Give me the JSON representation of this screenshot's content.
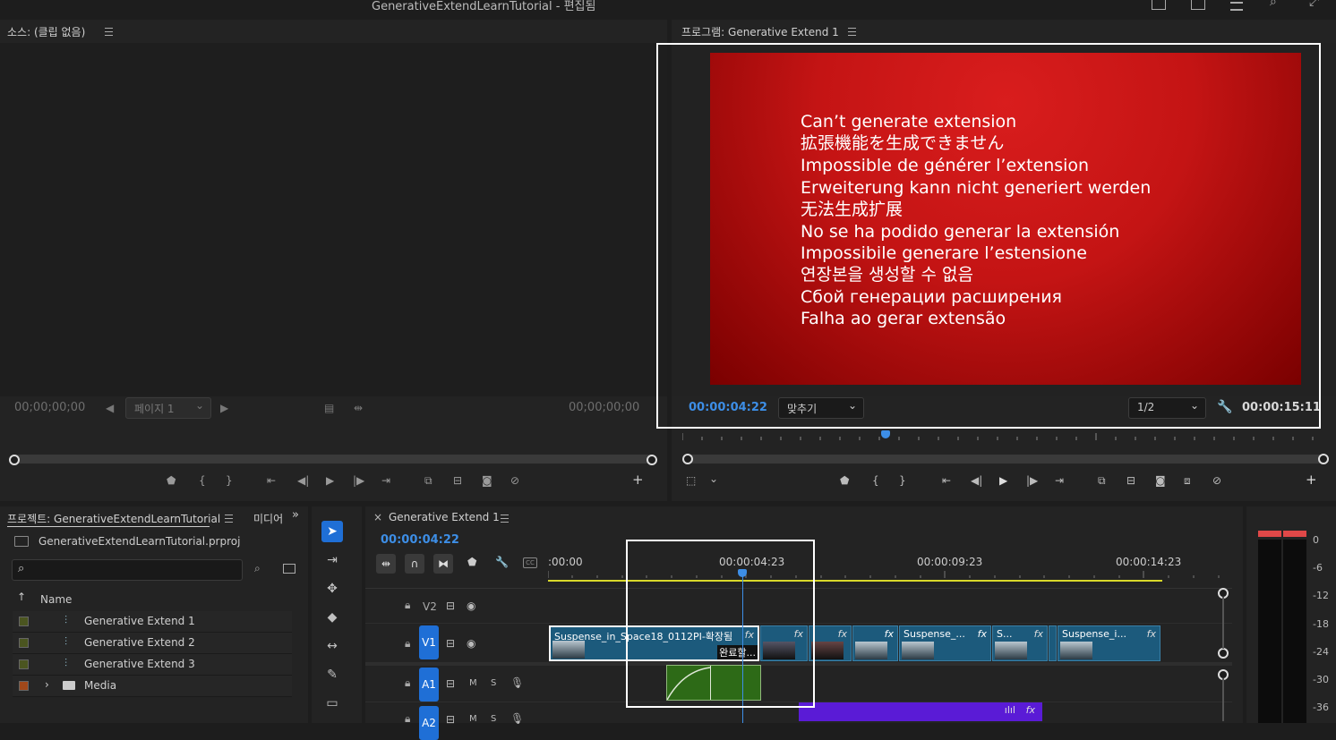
{
  "window": {
    "title": "GenerativeExtendLearnTutorial - 편집됨"
  },
  "source_monitor": {
    "header": "소스: (클립 없음)",
    "tc_in": "00;00;00;00",
    "tc_out": "00;00;00;00",
    "page_dropdown": "페이지 1"
  },
  "program_monitor": {
    "header": "프로그램: Generative Extend 1",
    "playhead_tc": "00:00:04:22",
    "fit_dropdown": "맞추기",
    "resolution_dropdown": "1/2",
    "duration_tc": "00:00:15:11",
    "error_lines": [
      "Can’t generate extension",
      "拡張機能を生成できません",
      "Impossible de générer l’extension",
      "Erweiterung kann nicht generiert werden",
      "无法生成扩展",
      "No se ha podido generar la extensión",
      "Impossibile generare l’estensione",
      "연장본을 생성할 수 없음",
      "Сбой генерации расширения",
      "Falha ao gerar extensão"
    ],
    "error_bg": "#c41414"
  },
  "project_panel": {
    "tab_label": "프로젝트: GenerativeExtendLearnTutorial",
    "tab2_label": "미디어",
    "file_name": "GenerativeExtendLearnTutorial.prproj",
    "column_name": "Name",
    "items": [
      {
        "name": "Generative Extend 1",
        "color": "#5a6a1e",
        "icon": "sequence-icon"
      },
      {
        "name": "Generative Extend 2",
        "color": "#5a6a1e",
        "icon": "sequence-icon"
      },
      {
        "name": "Generative Extend 3",
        "color": "#5a6a1e",
        "icon": "sequence-icon"
      },
      {
        "name": "Media",
        "color": "#b3501a",
        "icon": "folder-icon"
      }
    ]
  },
  "timeline": {
    "tab_label": "Generative Extend 1",
    "playhead_tc": "00:00:04:22",
    "ruler": [
      ":00:00",
      "00:00:04:23",
      "00:00:09:23",
      "00:00:14:23"
    ],
    "tracks": {
      "v2": "V2",
      "v1": "V1",
      "a1": "A1",
      "a2": "A2",
      "mute": "M",
      "solo": "S"
    },
    "clips": {
      "main_title": "Suspense_in_Space18_0112PI-확장됨",
      "main_badge": "완료할...",
      "clip_b": "Suspense_...",
      "clip_c": "S...",
      "clip_d": "Suspense_i...",
      "fx": "fx"
    },
    "accent": "#1f6fd6"
  },
  "audio_meter": {
    "ticks": [
      "0",
      "-6",
      "-12",
      "-18",
      "-24",
      "-30",
      "-36"
    ]
  }
}
